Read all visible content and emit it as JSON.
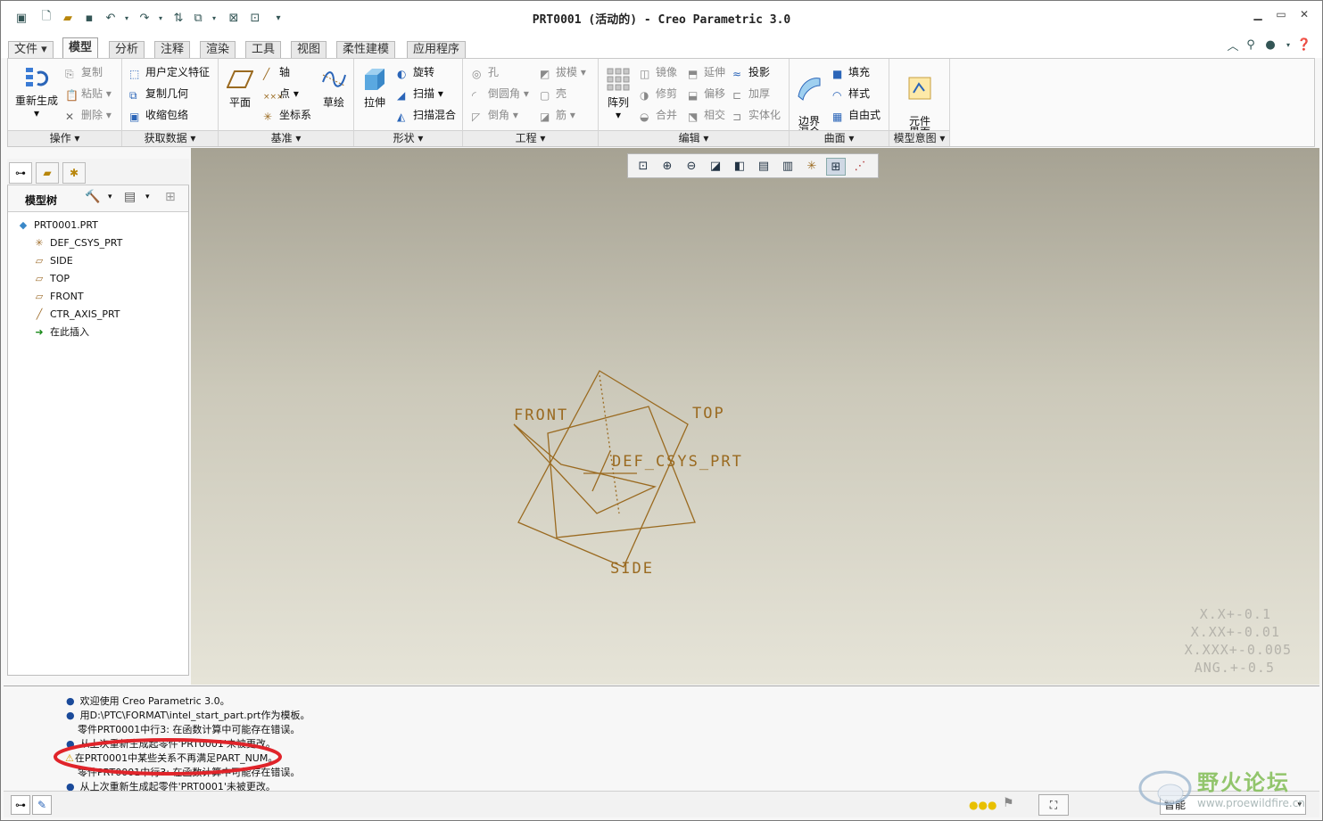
{
  "window": {
    "title": "PRT0001 (活动的) - Creo Parametric 3.0"
  },
  "tabs": [
    {
      "label": "文件"
    },
    {
      "label": "模型"
    },
    {
      "label": "分析"
    },
    {
      "label": "注释"
    },
    {
      "label": "渲染"
    },
    {
      "label": "工具"
    },
    {
      "label": "视图"
    },
    {
      "label": "柔性建模"
    },
    {
      "label": "应用程序"
    }
  ],
  "ribbon": {
    "ops": {
      "regen": "重新生成",
      "copy": "复制",
      "paste": "粘贴",
      "del": "删除",
      "label": "操作"
    },
    "getdata": {
      "udf": "用户定义特征",
      "copygeom": "复制几何",
      "shrink": "收缩包络",
      "label": "获取数据"
    },
    "datum": {
      "plane": "平面",
      "axis": "轴",
      "point": "点",
      "csys": "坐标系",
      "sketch": "草绘",
      "label": "基准"
    },
    "shapes": {
      "extrude": "拉伸",
      "revolve": "旋转",
      "sweep": "扫描",
      "swblend": "扫描混合",
      "label": "形状"
    },
    "eng": {
      "hole": "孔",
      "draft": "拔模",
      "round": "倒圆角",
      "shell": "壳",
      "chamfer": "倒角",
      "rib": "筋",
      "label": "工程"
    },
    "edit": {
      "pattern": "阵列",
      "mirror": "镜像",
      "extend": "延伸",
      "project": "投影",
      "trim": "修剪",
      "offset": "偏移",
      "thicken": "加厚",
      "merge": "合并",
      "intersect": "相交",
      "solidify": "实体化",
      "label": "编辑"
    },
    "surfaces": {
      "boundary": "边界\n混合",
      "fill": "填充",
      "style": "样式",
      "freestyle": "自由式",
      "label": "曲面"
    },
    "intent": {
      "ci": "元件\n界面",
      "label": "模型意图"
    }
  },
  "tree": {
    "header": "模型树",
    "items": [
      {
        "name": "PRT0001.PRT"
      },
      {
        "name": "DEF_CSYS_PRT"
      },
      {
        "name": "SIDE"
      },
      {
        "name": "TOP"
      },
      {
        "name": "FRONT"
      },
      {
        "name": "CTR_AXIS_PRT"
      },
      {
        "name": "在此插入"
      }
    ]
  },
  "datums": {
    "front": "FRONT",
    "top": "TOP",
    "csys": "DEF_CSYS_PRT",
    "side": "SIDE"
  },
  "tolerances": [
    "X.X+-0.1",
    "X.XX+-0.01",
    "X.XXX+-0.005",
    "ANG.+-0.5"
  ],
  "messages": [
    {
      "text": "欢迎使用 Creo Parametric 3.0。",
      "bullet": true
    },
    {
      "text": "用D:\\PTC\\FORMAT\\intel_start_part.prt作为模板。",
      "bullet": true
    },
    {
      "text": "零件PRT0001中行3: 在函数计算中可能存在错误。",
      "bullet": false
    },
    {
      "text": "从上次重新生成起零件'PRT0001'未被更改。",
      "bullet": true
    },
    {
      "text": "在PRT0001中某些关系不再满足PART_NUM。",
      "bullet": false,
      "warn": true
    },
    {
      "text": "零件PRT0001中行3: 在函数计算中可能存在错误。",
      "bullet": false
    },
    {
      "text": "从上次重新生成起零件'PRT0001'未被更改。",
      "bullet": true
    }
  ],
  "status": {
    "filter": "智能",
    "watermark": "野火论坛",
    "watermark_url": "www.proewildfire.cn"
  },
  "colors": {
    "datum": "#9a6a20",
    "annotation": "#e0242a"
  }
}
